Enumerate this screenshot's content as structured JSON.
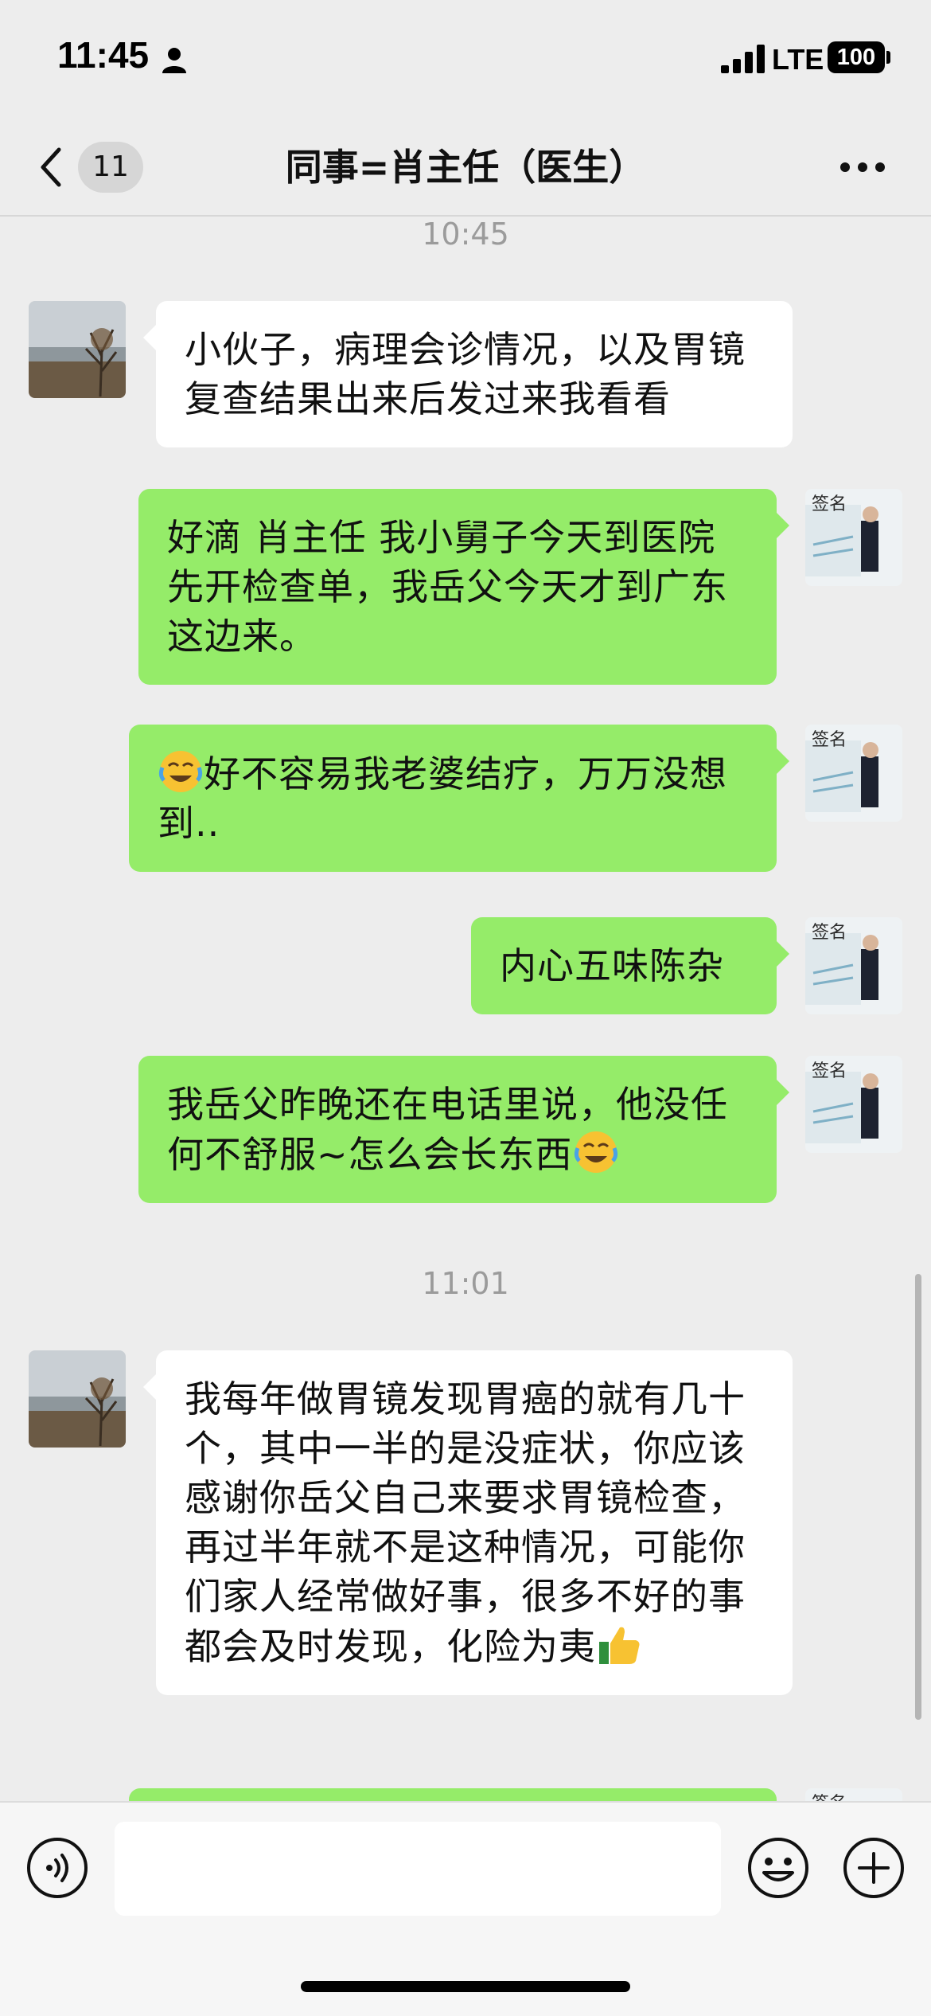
{
  "status_bar": {
    "time": "11:45",
    "network": "LTE",
    "battery": "100"
  },
  "nav": {
    "unread_count": "11",
    "title": "同事=肖主任（医生）"
  },
  "messages": [
    {
      "type": "time",
      "text": "10:45"
    },
    {
      "type": "in",
      "text": "小伙子，病理会诊情况，以及胃镜复查结果出来后发过来我看看"
    },
    {
      "type": "out",
      "text": "好滴 肖主任 我小舅子今天到医院先开检查单，我岳父今天才到广东这边来。"
    },
    {
      "type": "out",
      "emoji_before": "crying-laughing",
      "text": "好不容易我老婆结疗，万万没想到.."
    },
    {
      "type": "out",
      "text": "内心五味陈杂"
    },
    {
      "type": "out",
      "text": "我岳父昨晚还在电话里说，他没任何不舒服~怎么会长东西",
      "emoji_after": "crying-laughing"
    },
    {
      "type": "time",
      "text": "11:01"
    },
    {
      "type": "in",
      "text": "我每年做胃镜发现胃癌的就有几十个，其中一半的是没症状，你应该感谢你岳父自己来要求胃镜检查，再过半年就不是这种情况，可能你们家人经常做好事，很多不好的事都会及时发现，化险为夷",
      "emoji_after": "thumbs-up"
    }
  ],
  "input_bar": {
    "placeholder": ""
  },
  "colors": {
    "outgoing_bubble": "#95ec69",
    "incoming_bubble": "#ffffff",
    "background": "#ededed"
  }
}
